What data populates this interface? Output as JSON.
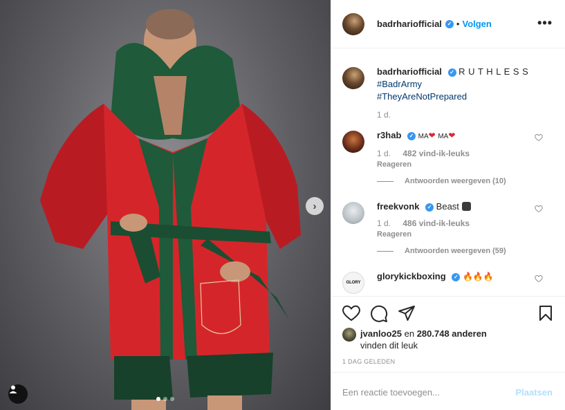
{
  "post": {
    "author": "badrhariofficial",
    "follow_label": "Volgen",
    "separator": "•",
    "more_icon": "more-horizontal-icon",
    "image_description_dots": 3
  },
  "caption": {
    "username": "badrhariofficial",
    "text": "R U T H L E S S",
    "hashtags": [
      "#BadrArmy",
      "#TheyAreNotPrepared"
    ],
    "time": "1 d."
  },
  "comments": [
    {
      "username": "r3hab",
      "text_parts": [
        "MA",
        "MA"
      ],
      "time": "1 d.",
      "likes": "482 vind-ik-leuks",
      "reply": "Reageren",
      "view_replies": "Antwoorden weergeven (10)"
    },
    {
      "username": "freekvonk",
      "text": "Beast",
      "time": "1 d.",
      "likes": "486 vind-ik-leuks",
      "reply": "Reageren",
      "view_replies": "Antwoorden weergeven (59)"
    },
    {
      "username": "glorykickboxing",
      "avatar_text": "GLORY"
    }
  ],
  "likes": {
    "user": "jvanloo25",
    "connector": "en",
    "others": "280.748 anderen",
    "suffix": "vinden dit leuk"
  },
  "time_ago": "1 DAG GELEDEN",
  "comment_input": {
    "placeholder": "Een reactie toevoegen...",
    "submit_label": "Plaatsen"
  },
  "colors": {
    "link_blue": "#0095f6",
    "verified_blue": "#3897f0",
    "robe_red": "#d4262a",
    "robe_green": "#1f5a3a"
  }
}
